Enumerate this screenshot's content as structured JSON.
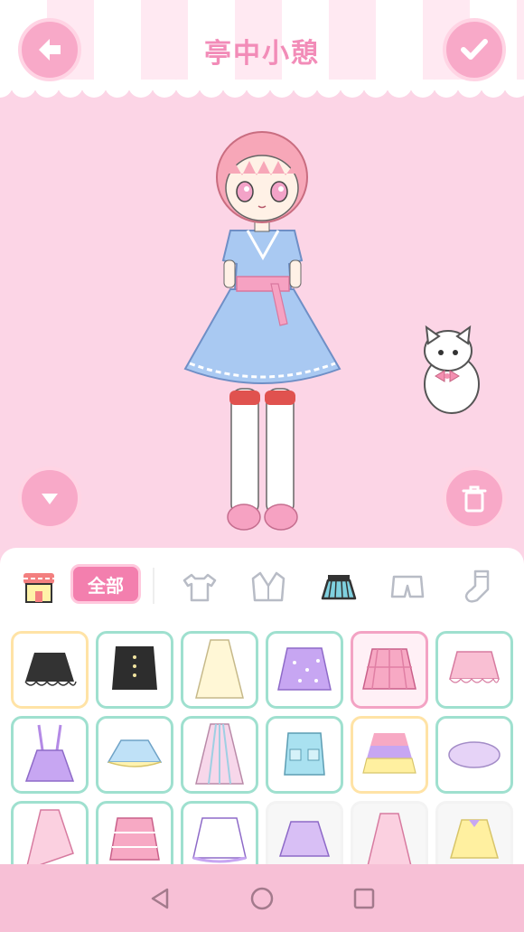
{
  "header": {
    "title": "亭中小憩"
  },
  "buttons": {
    "back": "back-arrow-icon",
    "confirm": "check-icon",
    "collapse": "chevron-down-icon",
    "delete": "trash-icon"
  },
  "categories": {
    "all_label": "全部",
    "tabs": [
      "shop-icon",
      "shirt-icon",
      "jacket-icon",
      "skirt-icon",
      "shorts-icon",
      "sock-icon"
    ],
    "selected": "skirt-icon"
  },
  "items": [
    "black-frill-skirt",
    "black-button-skirt",
    "cream-long-skirt",
    "lavender-dot-skirt",
    "pink-plaid-skirt",
    "pink-ruffle-skirt",
    "purple-suspender-skirt",
    "blue-tutu-skirt",
    "striped-long-skirt",
    "blue-pocket-skirt",
    "tiered-rainbow-skirt",
    "lilac-bubble-skirt",
    "pink-asym-skirt",
    "pink-check-skirt",
    "bow-white-skirt",
    "purple-lace-skirt",
    "pink-long-skirt",
    "yellow-ribbon-skirt"
  ],
  "colors": {
    "background": "#fcd5e6",
    "accent": "#f37fae",
    "button": "#f8a9c8",
    "cell_border": "#9fe0cf"
  }
}
